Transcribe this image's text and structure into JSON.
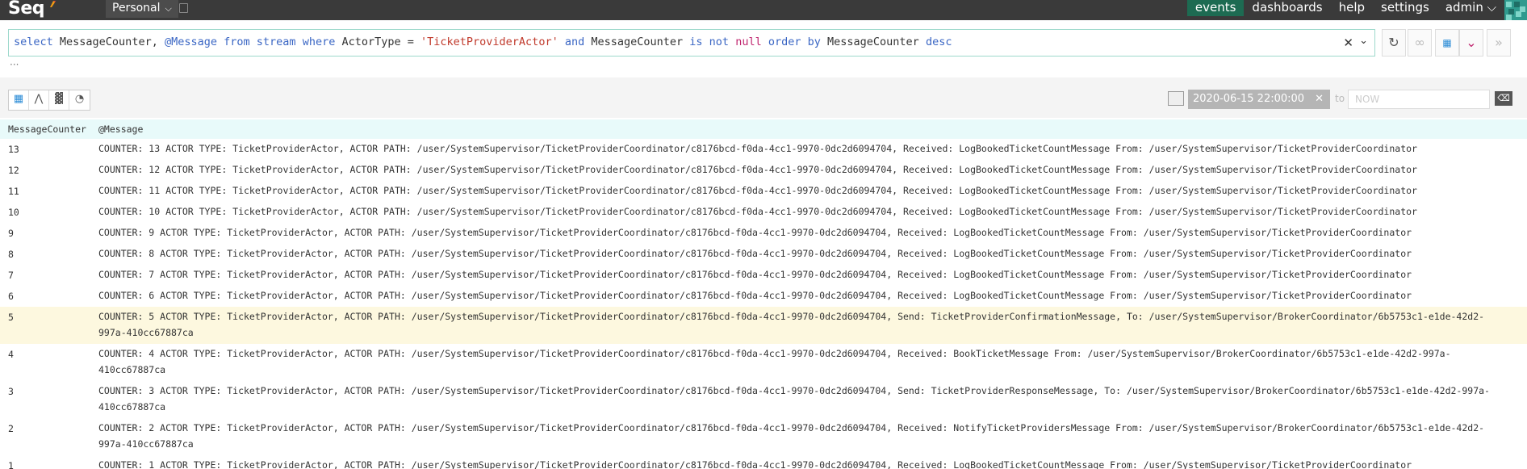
{
  "app": {
    "logo": "Seq",
    "workspace": "Personal"
  },
  "nav": [
    {
      "label": "events",
      "active": true
    },
    {
      "label": "dashboards",
      "active": false
    },
    {
      "label": "help",
      "active": false
    },
    {
      "label": "settings",
      "active": false
    },
    {
      "label": "admin",
      "active": false
    }
  ],
  "query": {
    "parts": [
      {
        "t": "select",
        "c": "kw"
      },
      {
        "t": " MessageCounter, ",
        "c": ""
      },
      {
        "t": "@Message",
        "c": "kw"
      },
      {
        "t": " ",
        "c": ""
      },
      {
        "t": "from",
        "c": "kw"
      },
      {
        "t": " ",
        "c": ""
      },
      {
        "t": "stream",
        "c": "kw"
      },
      {
        "t": " ",
        "c": ""
      },
      {
        "t": "where",
        "c": "kw"
      },
      {
        "t": " ActorType = ",
        "c": ""
      },
      {
        "t": "'TicketProviderActor'",
        "c": "str"
      },
      {
        "t": " ",
        "c": ""
      },
      {
        "t": "and",
        "c": "kw"
      },
      {
        "t": " MessageCounter ",
        "c": ""
      },
      {
        "t": "is not",
        "c": "kw"
      },
      {
        "t": " ",
        "c": ""
      },
      {
        "t": "null",
        "c": "nl"
      },
      {
        "t": " ",
        "c": ""
      },
      {
        "t": "order by",
        "c": "kw"
      },
      {
        "t": " MessageCounter ",
        "c": ""
      },
      {
        "t": "desc",
        "c": "kw"
      }
    ],
    "ellipsis": "···"
  },
  "time": {
    "from": "2020-06-15 22:00:00",
    "to_label": "to",
    "to_placeholder": "NOW"
  },
  "table": {
    "columns": [
      "MessageCounter",
      "@Message"
    ],
    "rows": [
      {
        "counter": "13",
        "message": "COUNTER: 13 ACTOR TYPE: TicketProviderActor, ACTOR PATH: /user/SystemSupervisor/TicketProviderCoordinator/c8176bcd-f0da-4cc1-9970-0dc2d6094704, Received: LogBookedTicketCountMessage From: /user/SystemSupervisor/TicketProviderCoordinator",
        "highlight": false
      },
      {
        "counter": "12",
        "message": "COUNTER: 12 ACTOR TYPE: TicketProviderActor, ACTOR PATH: /user/SystemSupervisor/TicketProviderCoordinator/c8176bcd-f0da-4cc1-9970-0dc2d6094704, Received: LogBookedTicketCountMessage From: /user/SystemSupervisor/TicketProviderCoordinator",
        "highlight": false
      },
      {
        "counter": "11",
        "message": "COUNTER: 11 ACTOR TYPE: TicketProviderActor, ACTOR PATH: /user/SystemSupervisor/TicketProviderCoordinator/c8176bcd-f0da-4cc1-9970-0dc2d6094704, Received: LogBookedTicketCountMessage From: /user/SystemSupervisor/TicketProviderCoordinator",
        "highlight": false
      },
      {
        "counter": "10",
        "message": "COUNTER: 10 ACTOR TYPE: TicketProviderActor, ACTOR PATH: /user/SystemSupervisor/TicketProviderCoordinator/c8176bcd-f0da-4cc1-9970-0dc2d6094704, Received: LogBookedTicketCountMessage From: /user/SystemSupervisor/TicketProviderCoordinator",
        "highlight": false
      },
      {
        "counter": "9",
        "message": "COUNTER: 9 ACTOR TYPE: TicketProviderActor, ACTOR PATH: /user/SystemSupervisor/TicketProviderCoordinator/c8176bcd-f0da-4cc1-9970-0dc2d6094704, Received: LogBookedTicketCountMessage From: /user/SystemSupervisor/TicketProviderCoordinator",
        "highlight": false
      },
      {
        "counter": "8",
        "message": "COUNTER: 8 ACTOR TYPE: TicketProviderActor, ACTOR PATH: /user/SystemSupervisor/TicketProviderCoordinator/c8176bcd-f0da-4cc1-9970-0dc2d6094704, Received: LogBookedTicketCountMessage From: /user/SystemSupervisor/TicketProviderCoordinator",
        "highlight": false
      },
      {
        "counter": "7",
        "message": "COUNTER: 7 ACTOR TYPE: TicketProviderActor, ACTOR PATH: /user/SystemSupervisor/TicketProviderCoordinator/c8176bcd-f0da-4cc1-9970-0dc2d6094704, Received: LogBookedTicketCountMessage From: /user/SystemSupervisor/TicketProviderCoordinator",
        "highlight": false
      },
      {
        "counter": "6",
        "message": "COUNTER: 6 ACTOR TYPE: TicketProviderActor, ACTOR PATH: /user/SystemSupervisor/TicketProviderCoordinator/c8176bcd-f0da-4cc1-9970-0dc2d6094704, Received: LogBookedTicketCountMessage From: /user/SystemSupervisor/TicketProviderCoordinator",
        "highlight": false
      },
      {
        "counter": "5",
        "message": "COUNTER: 5 ACTOR TYPE: TicketProviderActor, ACTOR PATH: /user/SystemSupervisor/TicketProviderCoordinator/c8176bcd-f0da-4cc1-9970-0dc2d6094704, Send: TicketProviderConfirmationMessage, To: /user/SystemSupervisor/BrokerCoordinator/6b5753c1-e1de-42d2-997a-410cc67887ca",
        "highlight": true
      },
      {
        "counter": "4",
        "message": "COUNTER: 4 ACTOR TYPE: TicketProviderActor, ACTOR PATH: /user/SystemSupervisor/TicketProviderCoordinator/c8176bcd-f0da-4cc1-9970-0dc2d6094704, Received: BookTicketMessage From: /user/SystemSupervisor/BrokerCoordinator/6b5753c1-e1de-42d2-997a-410cc67887ca",
        "highlight": false
      },
      {
        "counter": "3",
        "message": "COUNTER: 3 ACTOR TYPE: TicketProviderActor, ACTOR PATH: /user/SystemSupervisor/TicketProviderCoordinator/c8176bcd-f0da-4cc1-9970-0dc2d6094704, Send: TicketProviderResponseMessage, To: /user/SystemSupervisor/BrokerCoordinator/6b5753c1-e1de-42d2-997a-410cc67887ca",
        "highlight": false
      },
      {
        "counter": "2",
        "message": "COUNTER: 2 ACTOR TYPE: TicketProviderActor, ACTOR PATH: /user/SystemSupervisor/TicketProviderCoordinator/c8176bcd-f0da-4cc1-9970-0dc2d6094704, Received: NotifyTicketProvidersMessage From: /user/SystemSupervisor/BrokerCoordinator/6b5753c1-e1de-42d2-997a-410cc67887ca",
        "highlight": false
      },
      {
        "counter": "1",
        "message": "COUNTER: 1 ACTOR TYPE: TicketProviderActor, ACTOR PATH: /user/SystemSupervisor/TicketProviderCoordinator/c8176bcd-f0da-4cc1-9970-0dc2d6094704, Received: LogBookedTicketCountMessage From: /user/SystemSupervisor/TicketProviderCoordinator",
        "highlight": false
      }
    ]
  }
}
